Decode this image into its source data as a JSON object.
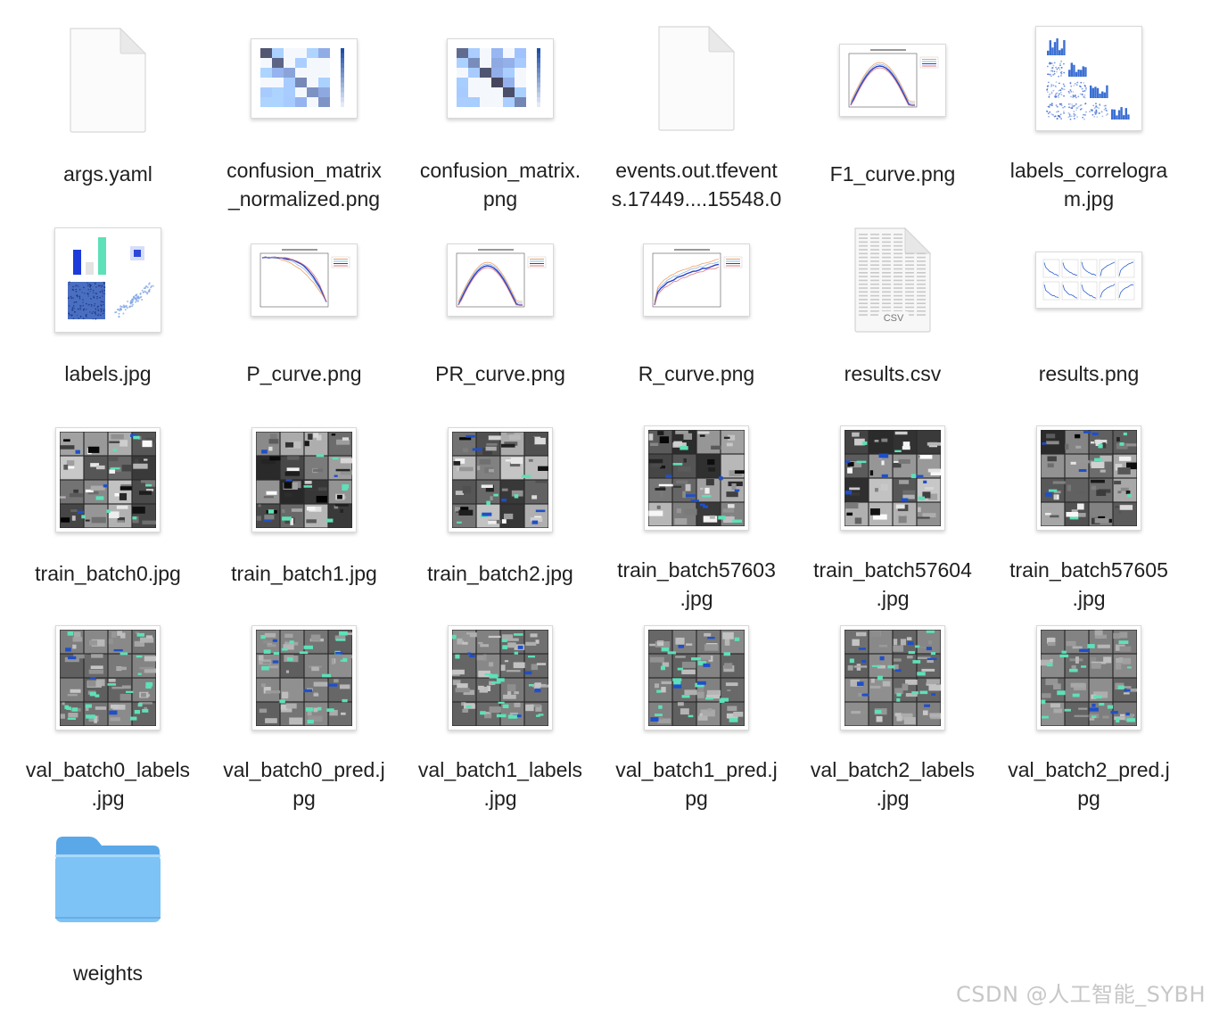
{
  "files": [
    {
      "name": "args.yaml",
      "kind": "document"
    },
    {
      "name": "confusion_matrix_normalized.png",
      "kind": "confusion"
    },
    {
      "name": "confusion_matrix.png",
      "kind": "confusion"
    },
    {
      "name": "events.out.tfevents.17449....15548.0",
      "kind": "document"
    },
    {
      "name": "F1_curve.png",
      "kind": "curve"
    },
    {
      "name": "labels_correlogram.jpg",
      "kind": "correlogram"
    },
    {
      "name": "labels.jpg",
      "kind": "labels"
    },
    {
      "name": "P_curve.png",
      "kind": "curve"
    },
    {
      "name": "PR_curve.png",
      "kind": "curve"
    },
    {
      "name": "R_curve.png",
      "kind": "curve"
    },
    {
      "name": "results.csv",
      "kind": "csv",
      "badge": "CSV"
    },
    {
      "name": "results.png",
      "kind": "results"
    },
    {
      "name": "train_batch0.jpg",
      "kind": "batch"
    },
    {
      "name": "train_batch1.jpg",
      "kind": "batch"
    },
    {
      "name": "train_batch2.jpg",
      "kind": "batch"
    },
    {
      "name": "train_batch57603.jpg",
      "kind": "batch"
    },
    {
      "name": "train_batch57604.jpg",
      "kind": "batch"
    },
    {
      "name": "train_batch57605.jpg",
      "kind": "batch"
    },
    {
      "name": "val_batch0_labels.jpg",
      "kind": "valbatch"
    },
    {
      "name": "val_batch0_pred.jpg",
      "kind": "valbatch"
    },
    {
      "name": "val_batch1_labels.jpg",
      "kind": "valbatch"
    },
    {
      "name": "val_batch1_pred.jpg",
      "kind": "valbatch"
    },
    {
      "name": "val_batch2_labels.jpg",
      "kind": "valbatch"
    },
    {
      "name": "val_batch2_pred.jpg",
      "kind": "valbatch"
    },
    {
      "name": "weights",
      "kind": "folder"
    }
  ],
  "labels": [
    "args.yaml",
    "confusion_matrix\n_normalized.png",
    "confusion_matrix.\npng",
    "events.out.tfevent\ns.17449....15548.0",
    "F1_curve.png",
    "labels_correlogra\nm.jpg",
    "labels.jpg",
    "P_curve.png",
    "PR_curve.png",
    "R_curve.png",
    "results.csv",
    "results.png",
    "train_batch0.jpg",
    "train_batch1.jpg",
    "train_batch2.jpg",
    "train_batch57603\n.jpg",
    "train_batch57604\n.jpg",
    "train_batch57605\n.jpg",
    "val_batch0_labels\n.jpg",
    "val_batch0_pred.j\npg",
    "val_batch1_labels\n.jpg",
    "val_batch1_pred.j\npg",
    "val_batch2_labels\n.jpg",
    "val_batch2_pred.j\npg",
    "weights"
  ],
  "watermark": "CSDN @人工智能_SYBH",
  "colors": {
    "folder": "#7ec3f5",
    "folder_tab": "#5aa8e8",
    "accent_blue": "#1f4fc9",
    "accent_teal": "#5ee0b8"
  }
}
